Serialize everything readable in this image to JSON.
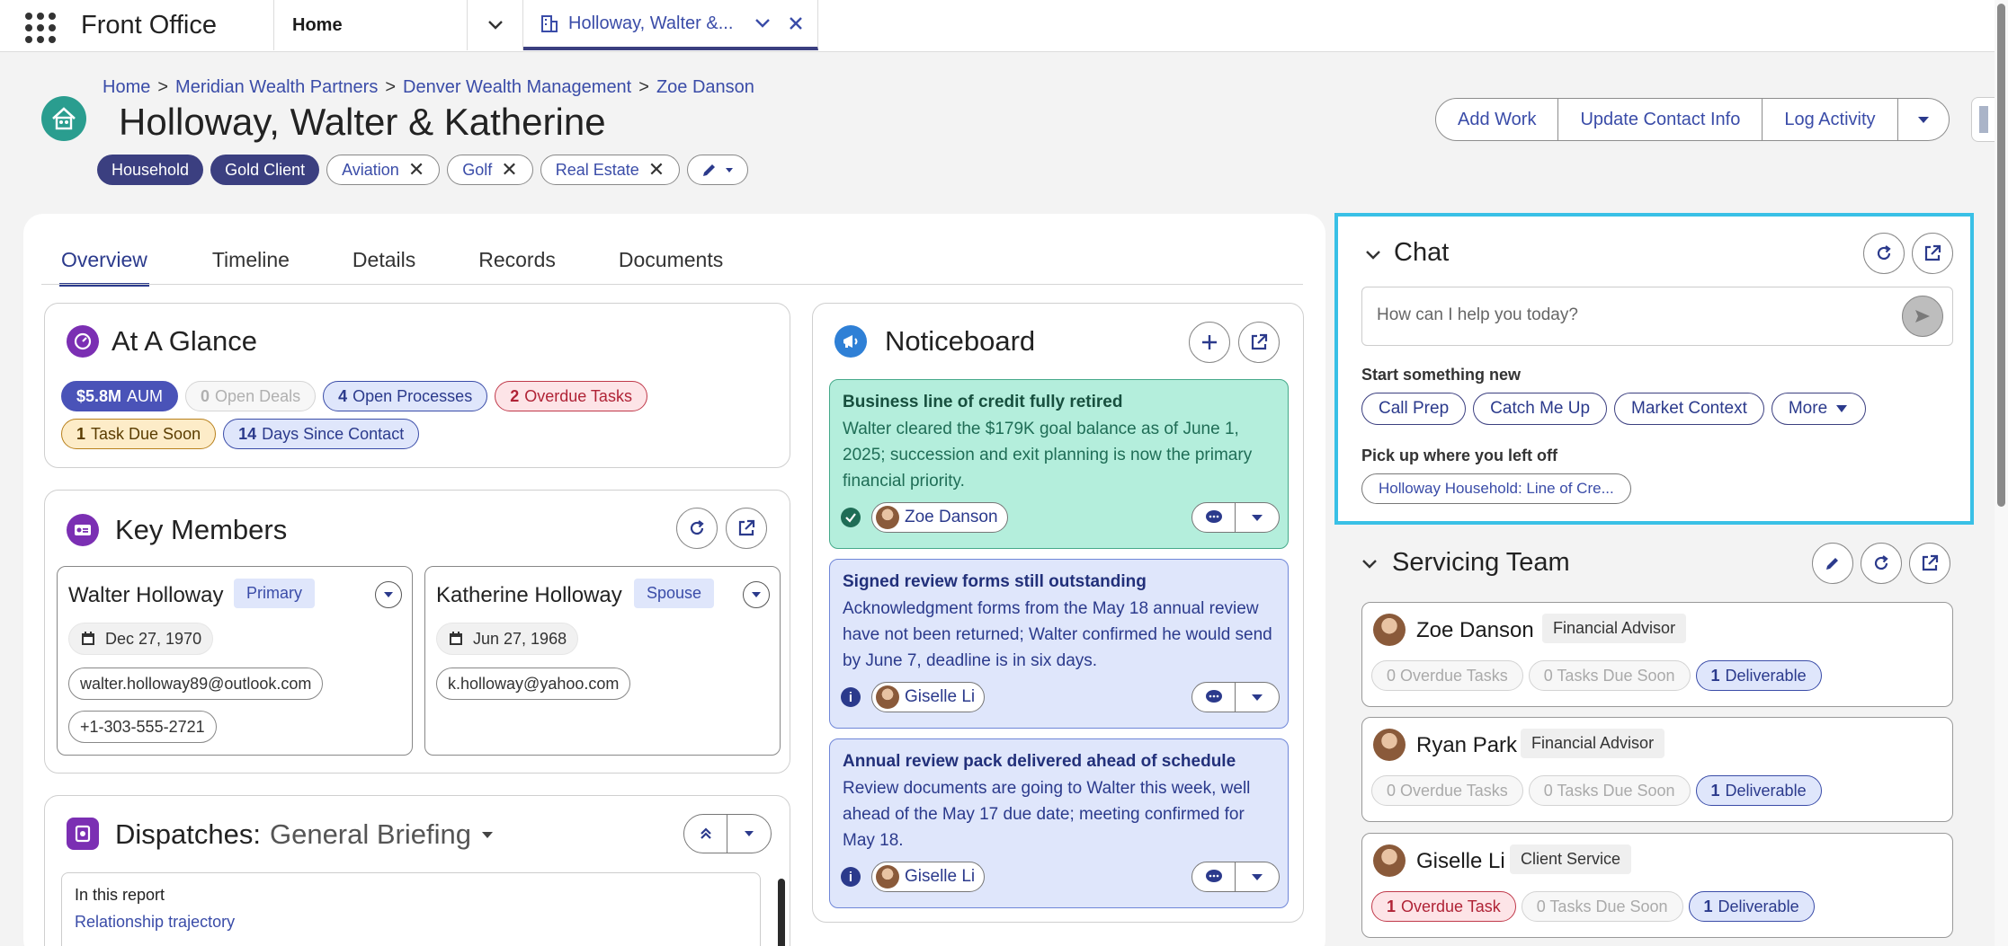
{
  "topbar": {
    "app_title": "Front Office",
    "tab_home": "Home",
    "tab_active": "Holloway, Walter &..."
  },
  "breadcrumb": [
    "Home",
    "Meridian Wealth Partners",
    "Denver Wealth Management",
    "Zoe Danson"
  ],
  "breadcrumb_sep": ">",
  "page_title": "Holloway, Walter & Katherine",
  "tags": {
    "solid": [
      "Household",
      "Gold Client"
    ],
    "removable": [
      "Aviation",
      "Golf",
      "Real Estate"
    ]
  },
  "actions": [
    "Add Work",
    "Update Contact Info",
    "Log Activity"
  ],
  "nav_tabs": [
    "Overview",
    "Timeline",
    "Details",
    "Records",
    "Documents"
  ],
  "glance": {
    "title": "At A Glance",
    "aum": {
      "num": "$5.8M",
      "label": "AUM"
    },
    "open_deals": {
      "num": "0",
      "label": "Open Deals"
    },
    "open_processes": {
      "num": "4",
      "label": "Open Processes"
    },
    "overdue": {
      "num": "2",
      "label": "Overdue Tasks"
    },
    "due_soon": {
      "num": "1",
      "label": "Task Due Soon"
    },
    "days_since": {
      "num": "14",
      "label": "Days Since Contact"
    }
  },
  "key_members": {
    "title": "Key Members",
    "members": [
      {
        "name": "Walter Holloway",
        "role": "Primary",
        "dob": "Dec 27, 1970",
        "email": "walter.holloway89@outlook.com",
        "phone": "+1-303-555-2721"
      },
      {
        "name": "Katherine Holloway",
        "role": "Spouse",
        "dob": "Jun 27, 1968",
        "email": "k.holloway@yahoo.com"
      }
    ]
  },
  "dispatches": {
    "title": "Dispatches:",
    "subtitle": "General Briefing",
    "in_report": "In this report",
    "link": "Relationship trajectory"
  },
  "noticeboard": {
    "title": "Noticeboard",
    "items": [
      {
        "title": "Business line of credit fully retired",
        "body": "Walter cleared the $179K goal balance as of June 1, 2025; succession and exit planning is now the primary financial priority.",
        "person": "Zoe Danson"
      },
      {
        "title": "Signed review forms still outstanding",
        "body": "Acknowledgment forms from the May 18 annual review have not been returned; Walter confirmed he would send by June 7, deadline is in six days.",
        "person": "Giselle Li"
      },
      {
        "title": "Annual review pack delivered ahead of schedule",
        "body": "Review documents are going to Walter this week, well ahead of the May 17 due date; meeting confirmed for May 18.",
        "person": "Giselle Li"
      }
    ]
  },
  "chat": {
    "title": "Chat",
    "placeholder": "How can I help you today?",
    "start_label": "Start something new",
    "quick": [
      "Call Prep",
      "Catch Me Up",
      "Market Context",
      "More"
    ],
    "pickup_label": "Pick up where you left off",
    "recent": "Holloway Household: Line of Cre..."
  },
  "servicing": {
    "title": "Servicing Team",
    "members": [
      {
        "name": "Zoe Danson",
        "role": "Financial Advisor",
        "overdue": "0 Overdue Tasks",
        "due": "0 Tasks Due Soon",
        "deliv_num": "1",
        "deliv": "Deliverable"
      },
      {
        "name": "Ryan Park",
        "role": "Financial Advisor",
        "overdue": "0 Overdue Tasks",
        "due": "0 Tasks Due Soon",
        "deliv_num": "1",
        "deliv": "Deliverable"
      },
      {
        "name": "Giselle Li",
        "role": "Client Service",
        "overdue_num": "1",
        "overdue_lbl": "Overdue Task",
        "due": "0 Tasks Due Soon",
        "deliv_num": "1",
        "deliv": "Deliverable"
      }
    ]
  }
}
